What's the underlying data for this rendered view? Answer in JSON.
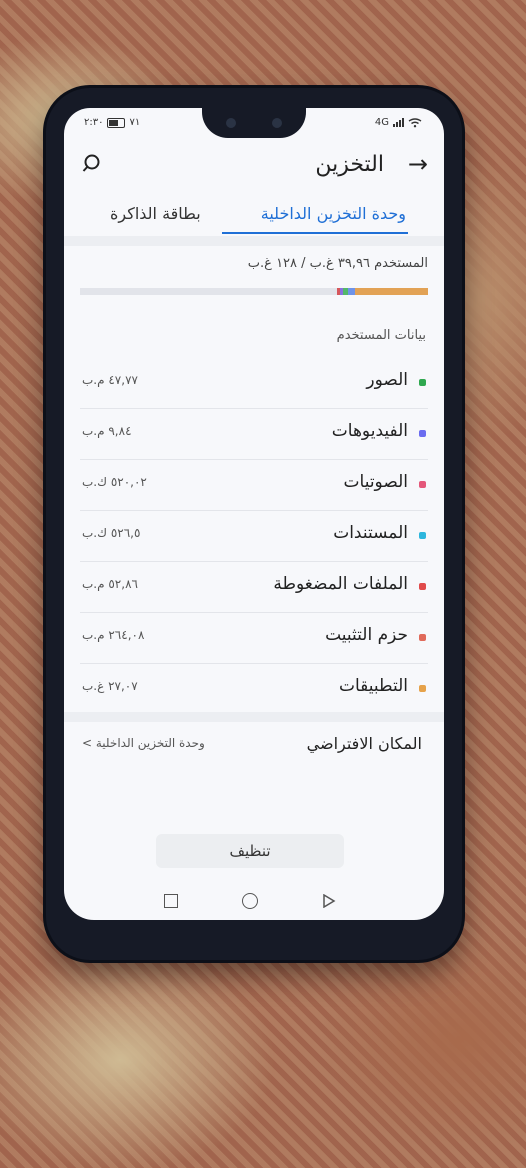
{
  "status_bar": {
    "time": "٢:٣٠",
    "battery_percent": "٧١",
    "network": "4G"
  },
  "header": {
    "title": "التخزين",
    "back_icon": "arrow-right-icon",
    "search_icon": "search-icon"
  },
  "tabs": [
    {
      "label": "وحدة التخزين الداخلية",
      "active": true
    },
    {
      "label": "بطاقة الذاكرة",
      "active": false
    }
  ],
  "storage": {
    "used_text": "المستخدم ٣٩,٩٦ غ.ب / ١٢٨ غ.ب",
    "used_fraction": 0.3122,
    "bar_segments": [
      {
        "name": "apps",
        "color": "#e2a255",
        "fraction": 0.21
      },
      {
        "name": "photos",
        "color": "#6f93e8",
        "fraction": 0.02
      },
      {
        "name": "images",
        "color": "#53b86a",
        "fraction": 0.015
      },
      {
        "name": "videos",
        "color": "#8a6fe0",
        "fraction": 0.01
      },
      {
        "name": "other",
        "color": "#d6565c",
        "fraction": 0.008
      }
    ]
  },
  "section_label": "بيانات المستخدم",
  "categories": [
    {
      "label": "الصور",
      "size": "٤٧,٧٧ م.ب",
      "color": "#2fa84f"
    },
    {
      "label": "الفيديوهات",
      "size": "٩,٨٤ م.ب",
      "color": "#6b6cf0"
    },
    {
      "label": "الصوتيات",
      "size": "٥٢٠,٠٢ ك.ب",
      "color": "#e4577a"
    },
    {
      "label": "المستندات",
      "size": "٥٢٦,٥ ك.ب",
      "color": "#2db6dd"
    },
    {
      "label": "الملفات المضغوطة",
      "size": "٥٢,٨٦ م.ب",
      "color": "#e04a4a"
    },
    {
      "label": "حزم التثبيت",
      "size": "٢٦٤,٠٨ م.ب",
      "color": "#e06a5a"
    },
    {
      "label": "التطبيقات",
      "size": "٢٧,٠٧ غ.ب",
      "color": "#e6a24a"
    }
  ],
  "default_location": {
    "title": "المكان الافتراضي",
    "value": "وحدة التخزين الداخلية >"
  },
  "clean_button": "تنظيف",
  "nav": {
    "recent_icon": "square-icon",
    "home_icon": "circle-icon",
    "back_icon": "triangle-back-icon"
  }
}
